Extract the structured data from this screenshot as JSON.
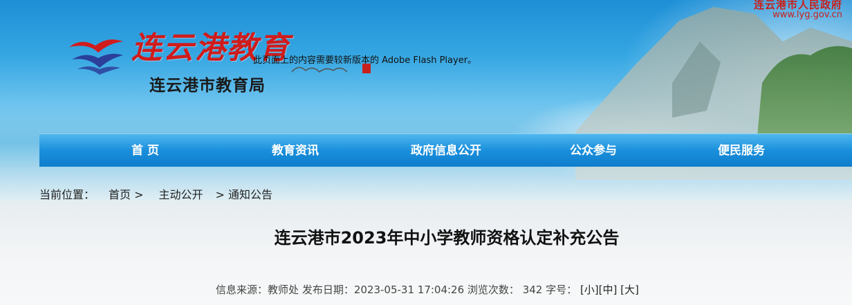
{
  "header": {
    "logo_icon": "seagull-wave-logo",
    "site_title": "连云港教育",
    "site_subtitle": "连云港市教育局",
    "flash_notice": "此页面上的内容需要较新版本的 Adobe Flash Player。",
    "gov_name": "连云港市人民政府",
    "gov_url": "www.lyg.gov.cn"
  },
  "nav": {
    "items": [
      {
        "label": "首 页"
      },
      {
        "label": "教育资讯"
      },
      {
        "label": "政府信息公开"
      },
      {
        "label": "公众参与"
      },
      {
        "label": "便民服务"
      }
    ]
  },
  "breadcrumb": {
    "prefix": "当前位置：",
    "items": [
      "首页 >",
      "主动公开",
      "> 通知公告"
    ]
  },
  "article": {
    "title": "连云港市2023年中小学教师资格认定补充公告",
    "meta": {
      "source_label": "信息来源：",
      "source": "教师处",
      "date_label": "发布日期：",
      "date": "2023-05-31 17:04:26",
      "views_label": "浏览次数：",
      "views": "342",
      "font_label": "字号：",
      "size_small": "[小]",
      "size_medium": "[中]",
      "size_large": "[大]"
    }
  },
  "colors": {
    "nav_bg": "#1a8fdc",
    "logo_red": "#d01c1c",
    "gov_red": "#c8201c"
  }
}
